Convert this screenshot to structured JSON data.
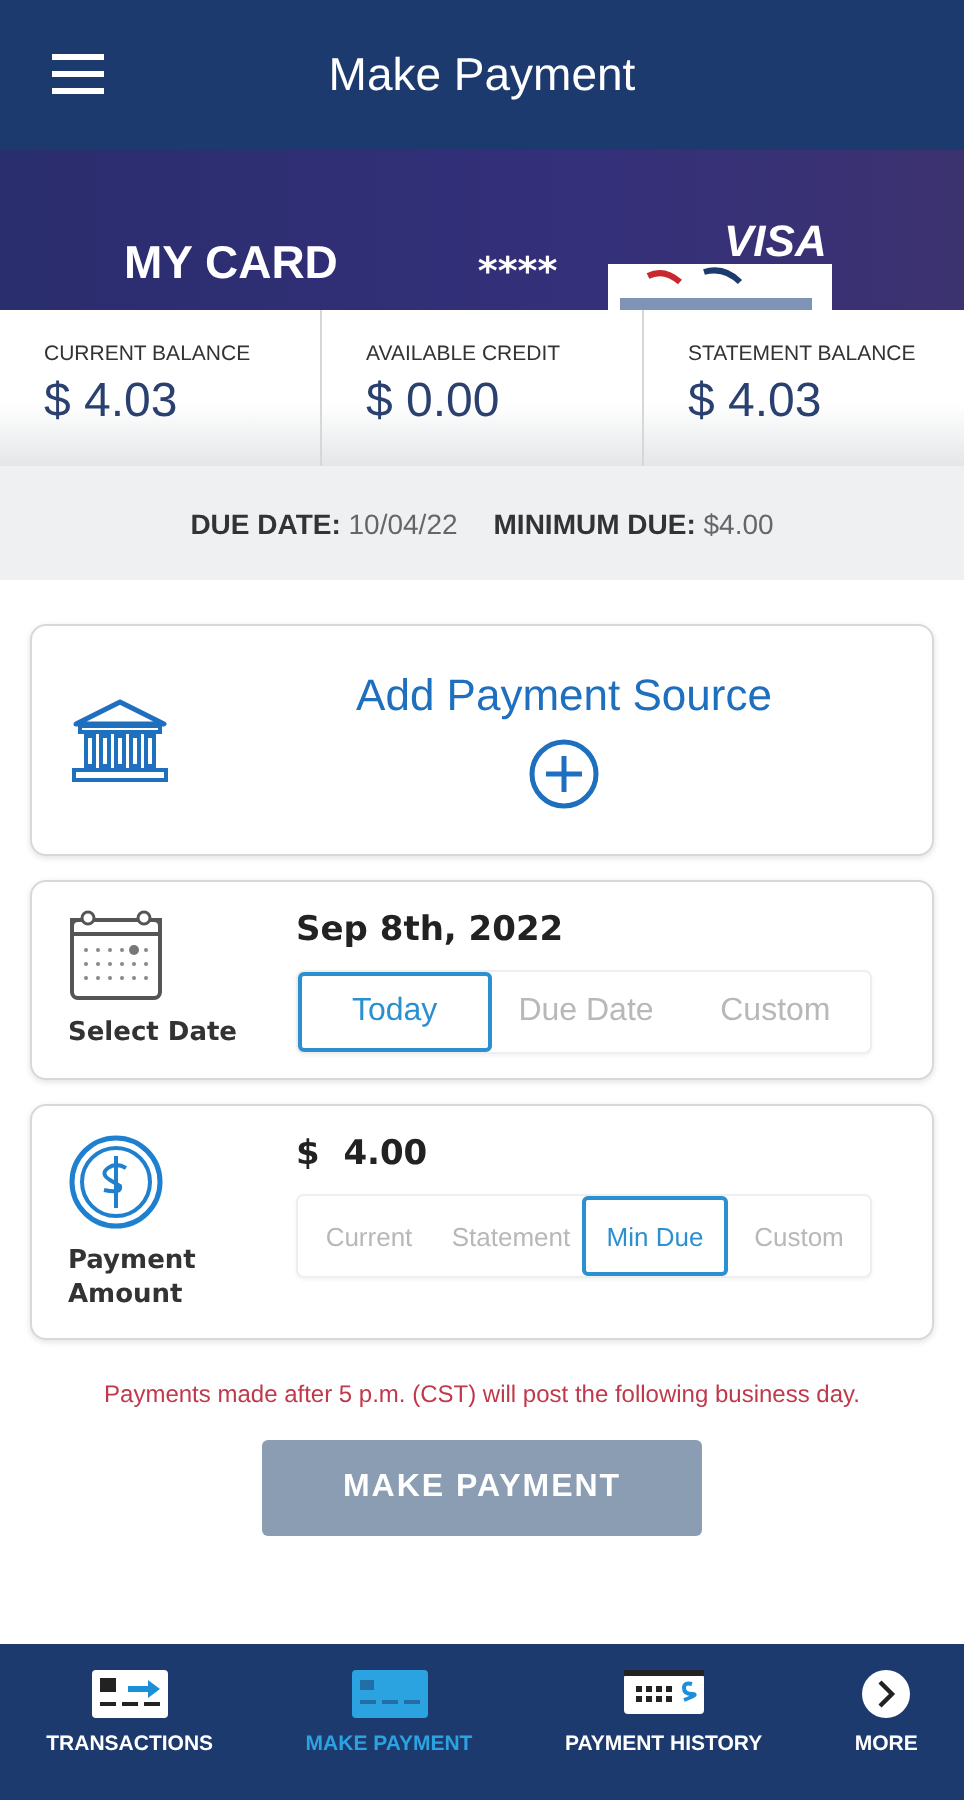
{
  "header": {
    "title": "Make Payment"
  },
  "card": {
    "name": "MY CARD",
    "number": "****",
    "brand": "VISA"
  },
  "balances": [
    {
      "label": "CURRENT BALANCE",
      "value": "$ 4.03"
    },
    {
      "label": "AVAILABLE CREDIT",
      "value": "$ 0.00"
    },
    {
      "label": "STATEMENT BALANCE",
      "value": "$ 4.03"
    }
  ],
  "due": {
    "date_label": "DUE DATE:",
    "date": "10/04/22",
    "min_label": "MINIMUM DUE:",
    "min": "$4.00"
  },
  "source": {
    "label": "Add Payment Source"
  },
  "date_panel": {
    "label": "Select Date",
    "value": "Sep 8th, 2022",
    "options": [
      {
        "label": "Today",
        "selected": true
      },
      {
        "label": "Due Date",
        "selected": false
      },
      {
        "label": "Custom",
        "selected": false
      }
    ]
  },
  "amount_panel": {
    "label": "Payment Amount",
    "currency": "$",
    "value": "4.00",
    "options": [
      {
        "label": "Current",
        "selected": false
      },
      {
        "label": "Statement",
        "selected": false
      },
      {
        "label": "Min Due",
        "selected": true
      },
      {
        "label": "Custom",
        "selected": false
      }
    ]
  },
  "notice": "Payments made after 5 p.m. (CST) will post the following business day.",
  "submit": {
    "label": "MAKE PAYMENT",
    "disabled": true
  },
  "nav": [
    {
      "label": "TRANSACTIONS",
      "kind": "transactions",
      "selected": false
    },
    {
      "label": "MAKE PAYMENT",
      "kind": "payment",
      "selected": true
    },
    {
      "label": "PAYMENT HISTORY",
      "kind": "history",
      "selected": false
    },
    {
      "label": "MORE",
      "kind": "more",
      "selected": false
    }
  ]
}
